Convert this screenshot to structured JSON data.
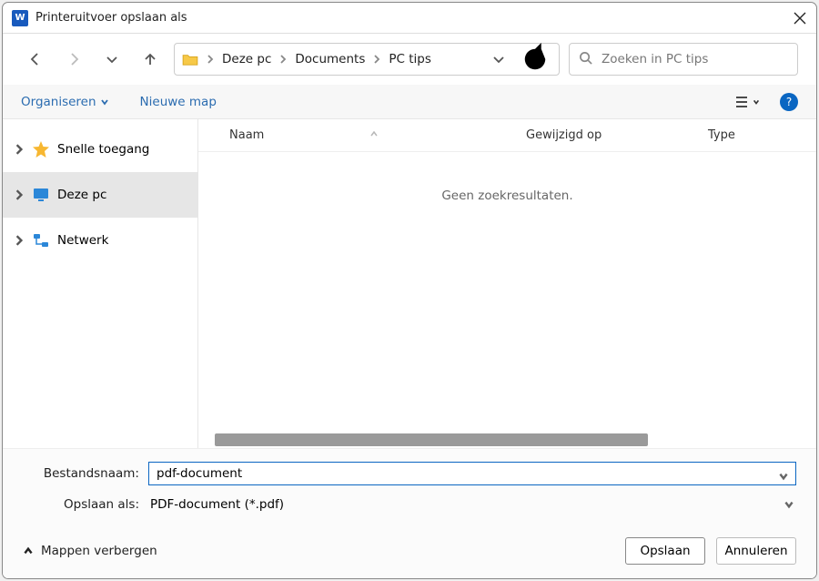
{
  "titlebar": {
    "title": "Printeruitvoer opslaan als"
  },
  "nav": {
    "breadcrumb": [
      "Deze pc",
      "Documents",
      "PC tips"
    ],
    "search_placeholder": "Zoeken in PC tips"
  },
  "toolbar": {
    "organize": "Organiseren",
    "new_folder": "Nieuwe map"
  },
  "sidebar": {
    "items": [
      {
        "label": "Snelle toegang"
      },
      {
        "label": "Deze pc"
      },
      {
        "label": "Netwerk"
      }
    ],
    "selected_index": 1
  },
  "columns": {
    "name": "Naam",
    "modified": "Gewijzigd op",
    "type": "Type"
  },
  "main": {
    "empty": "Geen zoekresultaten."
  },
  "form": {
    "filename_label": "Bestandsnaam:",
    "filename_value": "pdf-document",
    "saveas_label": "Opslaan als:",
    "saveas_value": "PDF-document (*.pdf)"
  },
  "footer": {
    "hide_folders": "Mappen verbergen",
    "save": "Opslaan",
    "cancel": "Annuleren"
  },
  "help_glyph": "?"
}
